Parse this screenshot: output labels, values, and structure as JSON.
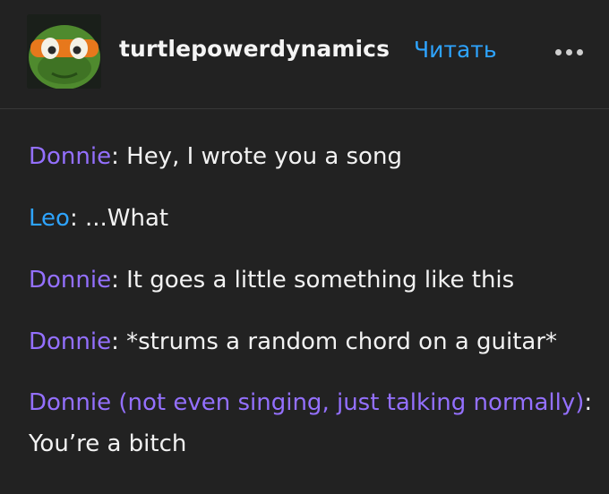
{
  "post": {
    "username": "turtlepowerdynamics",
    "follow_label": "Читать",
    "more_icon": "ellipsis-icon",
    "avatar_icon": "turtle-avatar-icon"
  },
  "dialogue": [
    {
      "speaker": "Donnie",
      "separator": ":",
      "text": " Hey, I wrote you a song"
    },
    {
      "speaker": "Leo",
      "separator": ":",
      "text": " ...What"
    },
    {
      "speaker": "Donnie",
      "separator": ":",
      "text": " It goes a little something like this"
    },
    {
      "speaker": "Donnie",
      "separator": ":",
      "text": " *strums a random chord on a guitar*"
    },
    {
      "speaker": "Donnie (not even singing, just talking normally)",
      "separator": ":",
      "text": " You’re a bitch"
    }
  ],
  "colors": {
    "background": "#222222",
    "accent_blue": "#2ea4ff",
    "accent_purple": "#9470ff",
    "text": "#f2f2f2"
  }
}
